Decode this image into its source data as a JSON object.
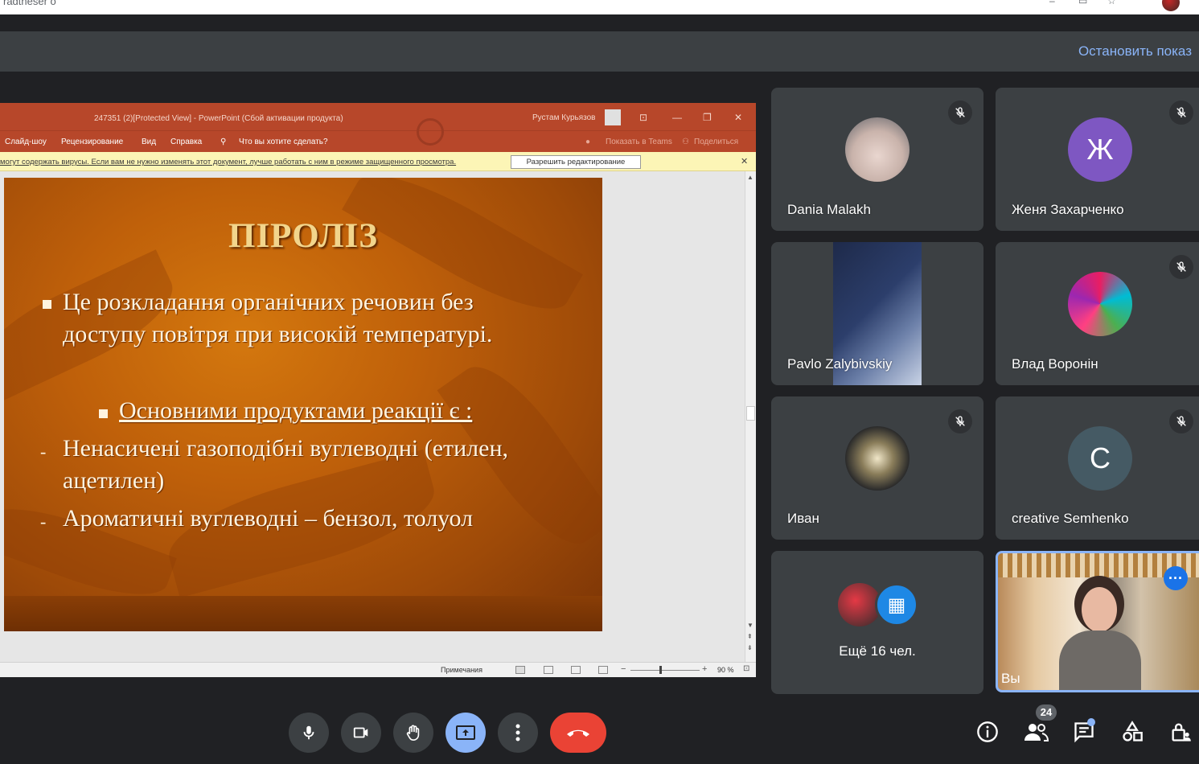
{
  "browser": {
    "url_fragment": "radtneser o"
  },
  "banner": {
    "stop_label": "Остановить показ"
  },
  "powerpoint": {
    "window_title": "247351 (2)[Protected View]  -  PowerPoint (Сбой активации продукта)",
    "user": "Рустам Курьязов",
    "ribbon": [
      "Слайд-шоу",
      "Рецензирование",
      "Вид",
      "Справка"
    ],
    "tell_me": "Что вы хотите сделать?",
    "show_teams": "Показать в Teams",
    "share": "Поделиться",
    "protected_message": "могут содержать вирусы. Если вам не нужно изменять этот документ, лучше работать с ним в режиме защищенного просмотра.",
    "enable_editing": "Разрешить редактирование",
    "notes": "Примечания",
    "zoom": "90 %"
  },
  "slide": {
    "title": "ПІРОЛІЗ",
    "point1_line1": "Це розкладання органічних речовин без",
    "point1_line2": "доступу повітря при високій температурі.",
    "subheading": "Основними продуктами реакції є :",
    "item1_line1": "Ненасичені газоподібні вуглеводні (етилен,",
    "item1_line2": "ацетилен)",
    "item2": "Ароматичні вуглеводні – бензол, толуол",
    "dash": "-"
  },
  "participants": [
    {
      "name": "Dania Malakh",
      "muted": true
    },
    {
      "name": "Женя Захарченко",
      "muted": true,
      "initial": "Ж",
      "color": "#7e57c2"
    },
    {
      "name": "Pavlo Zalybivskiy",
      "muted": false
    },
    {
      "name": "Влад Воронін",
      "muted": true
    },
    {
      "name": "Иван",
      "muted": true
    },
    {
      "name": "creative Semhenko",
      "muted": true,
      "initial": "C",
      "color": "#455a64"
    }
  ],
  "more_tile": {
    "label": "Ещё 16 чел."
  },
  "self_tile": {
    "label": "Вы"
  },
  "controls": {
    "participant_count": "24",
    "end_call_color": "#ea4335",
    "present_color": "#8ab4f8"
  }
}
